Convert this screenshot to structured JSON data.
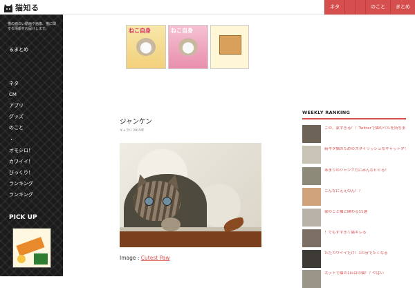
{
  "header": {
    "logo_text": "猫知る",
    "nav": [
      "ネタ",
      "",
      "",
      "のこと",
      "まとめ"
    ]
  },
  "sidebar": {
    "description": "猫の面白い動画や画像、猫に関する情報をお届けします。",
    "menu": [
      "るまとめ",
      "",
      "",
      "ネタ",
      "CM",
      "アプリ",
      "グッズ",
      "のこと",
      "・",
      "オモシロ！",
      "カワイイ！",
      "びっくり！",
      "ランキング",
      "ランキング"
    ],
    "pickup_title": "PICK UP",
    "pickup_image": "pickup-banner"
  },
  "banners": [
    {
      "title": "ねこ自身",
      "image": "magazine-cover-yellow"
    },
    {
      "title": "ねこ自身",
      "image": "magazine-cover-pink"
    },
    {
      "title": "",
      "image": "cat-house-kit"
    }
  ],
  "post": {
    "category": "",
    "title": "ジャンケン",
    "meta": "ギャラリ  2015年",
    "photo": "kitten-peeking-photo",
    "caption_prefix": "Image : ",
    "caption_link": "Cutest Paw"
  },
  "ranking": {
    "title": "WEEKLY RANKING",
    "items": [
      "この、家すぎる！！Twitterで猫のベルを持ちまくる猫",
      "新ネタ猫のためのスタイリッシュなキャットタワー",
      "あまりのジャンプ力にみんなビビる！",
      "こんなにええのん！？",
      "家のこと猫に関わる11選",
      "！でもすすぎて猫キレる",
      "ただカワイイだけ！1わ分でたくなる",
      "ネットで猫の1匹目の猫！？やばい"
    ]
  },
  "colors": {
    "accent": "#d64f4f",
    "sidebar_bg": "#1b1b1b",
    "link": "#d64f4f"
  }
}
